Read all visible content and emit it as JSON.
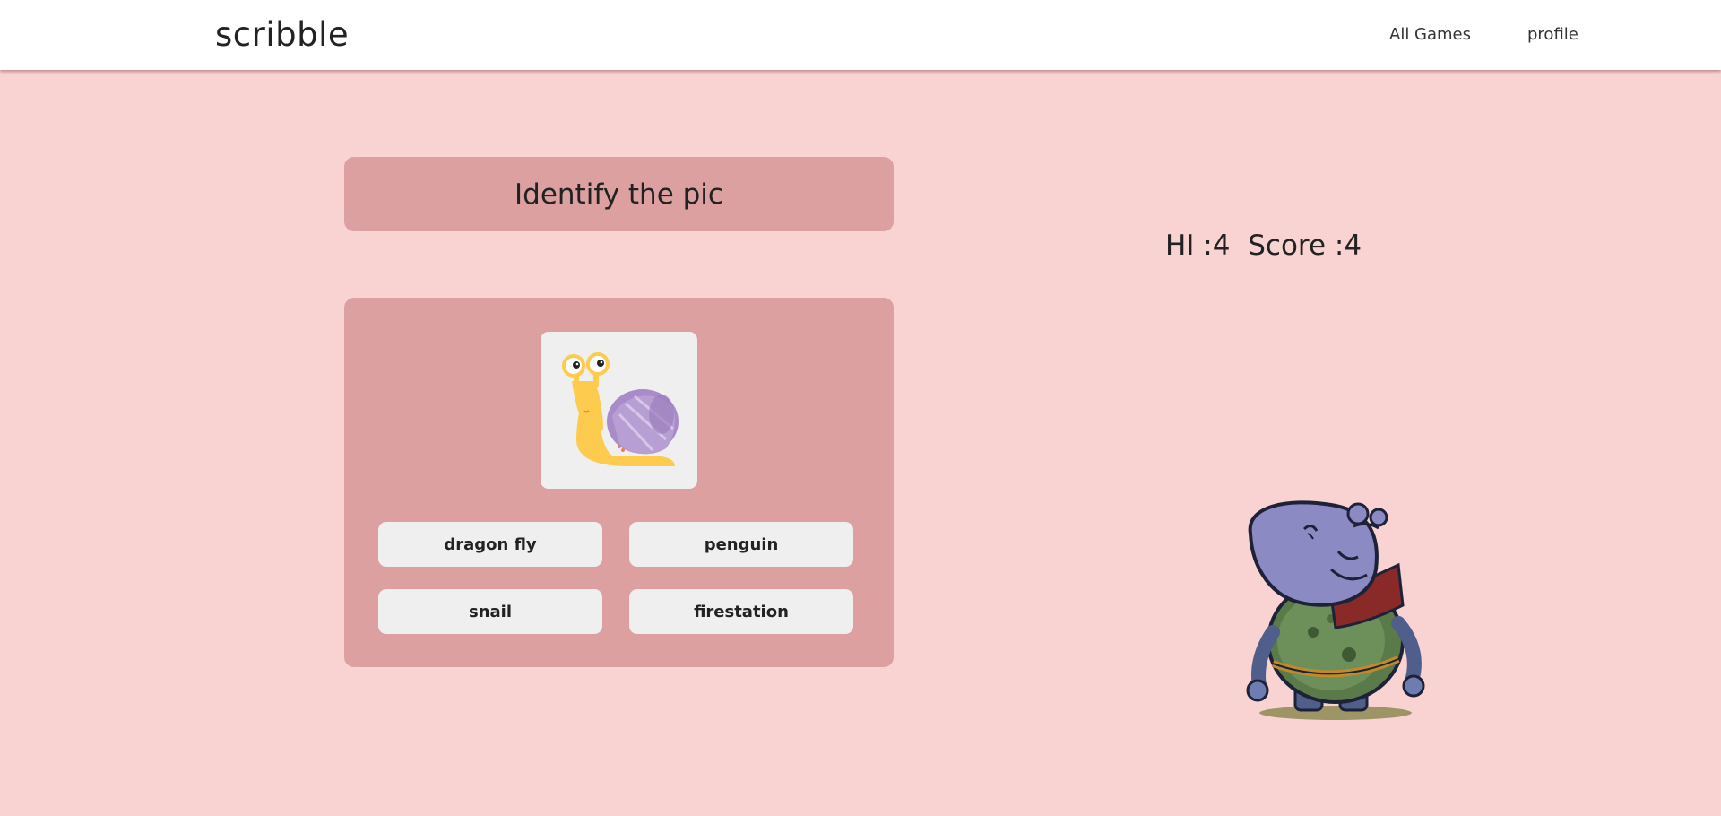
{
  "header": {
    "brand": "scribble",
    "nav": [
      {
        "label": "All Games"
      },
      {
        "label": "profile"
      }
    ]
  },
  "game": {
    "title": "Identify the pic",
    "image_icon": "snail-illustration",
    "options": [
      "dragon fly",
      "penguin",
      "snail",
      "firestation"
    ]
  },
  "scoreboard": {
    "hi_label": "HI :",
    "hi_value": "4",
    "score_label": "Score :",
    "score_value": "4"
  },
  "mascot": {
    "icon": "hippo-character"
  },
  "colors": {
    "page_background": "#f9d3d2",
    "card_background": "#dda0a1",
    "button_background": "#efefef",
    "header_background": "#ffffff"
  }
}
